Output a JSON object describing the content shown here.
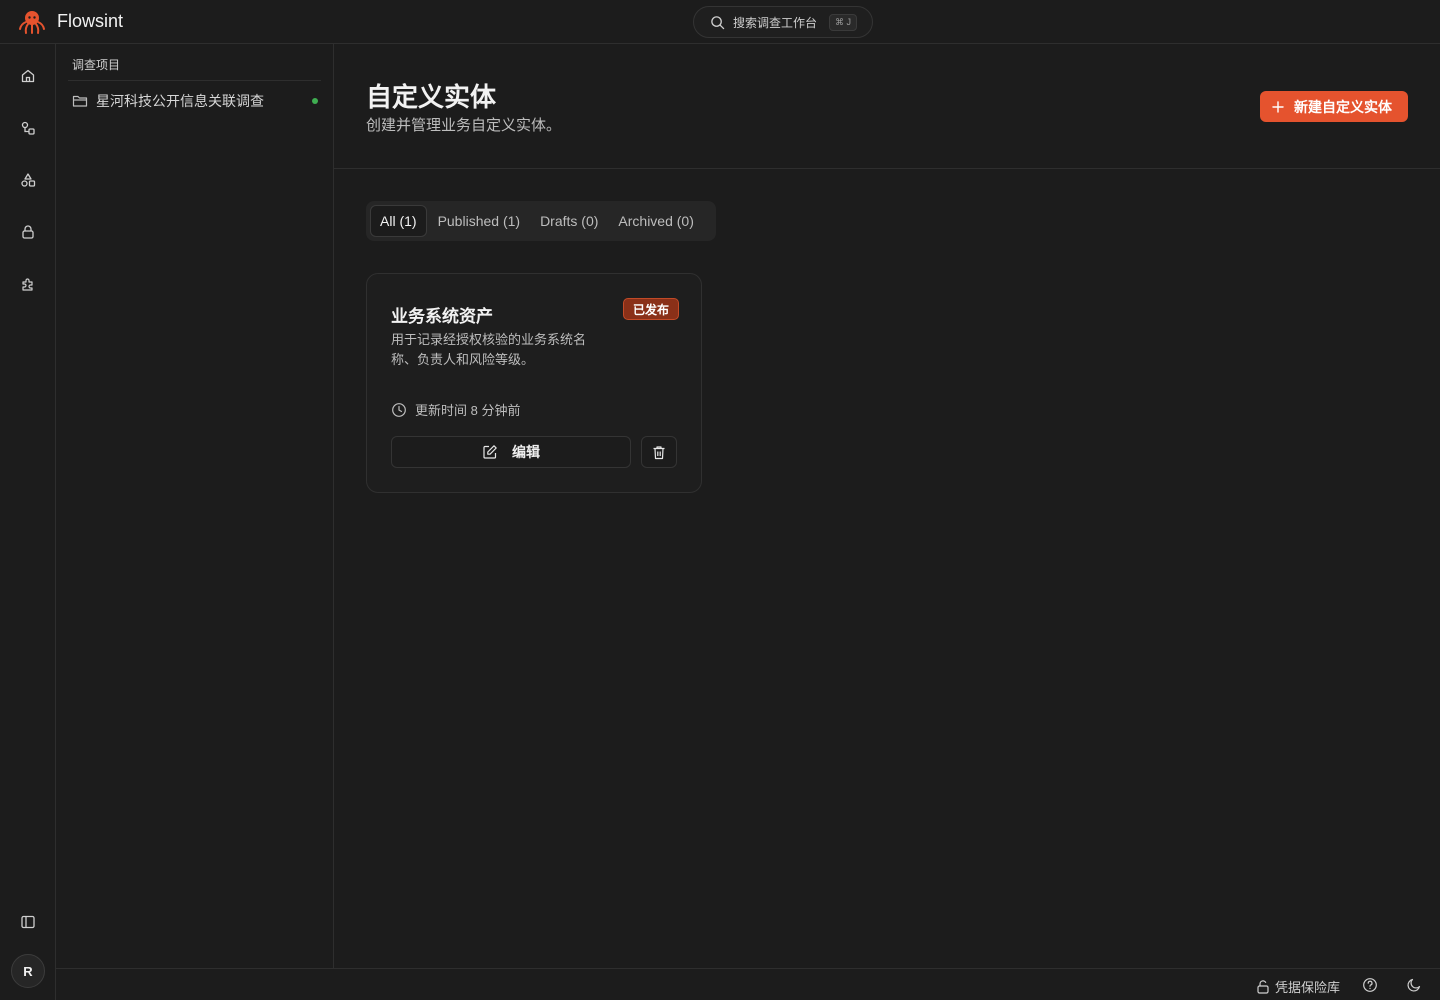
{
  "app": {
    "title": "Flowsint"
  },
  "search": {
    "label": "搜索调查工作台",
    "shortcut": "⌘ J"
  },
  "rail": {
    "items": [
      {
        "icon": "home-icon"
      },
      {
        "icon": "flow-icon"
      },
      {
        "icon": "shapes-icon"
      },
      {
        "icon": "lock-icon"
      },
      {
        "icon": "puzzle-icon"
      }
    ],
    "avatar_initial": "R"
  },
  "projects": {
    "heading": "调查项目",
    "items": [
      {
        "name": "星河科技公开信息关联调查",
        "status": "online"
      }
    ]
  },
  "page": {
    "title": "自定义实体",
    "subtitle": "创建并管理业务自定义实体。",
    "new_button": "新建自定义实体"
  },
  "tabs": [
    {
      "label": "All (1)",
      "active": true
    },
    {
      "label": "Published (1)",
      "active": false
    },
    {
      "label": "Drafts (0)",
      "active": false
    },
    {
      "label": "Archived (0)",
      "active": false
    }
  ],
  "cards": [
    {
      "title": "业务系统资产",
      "badge": "已发布",
      "description": "用于记录经授权核验的业务系统名称、负责人和风险等级。",
      "updated": "更新时间 8 分钟前",
      "edit_label": "编辑"
    }
  ],
  "statusbar": {
    "vault_label": "凭据保险库"
  },
  "colors": {
    "accent": "#e5532e",
    "badge_bg": "#8a3018",
    "online": "#3fae51",
    "background": "#1c1c1c"
  }
}
